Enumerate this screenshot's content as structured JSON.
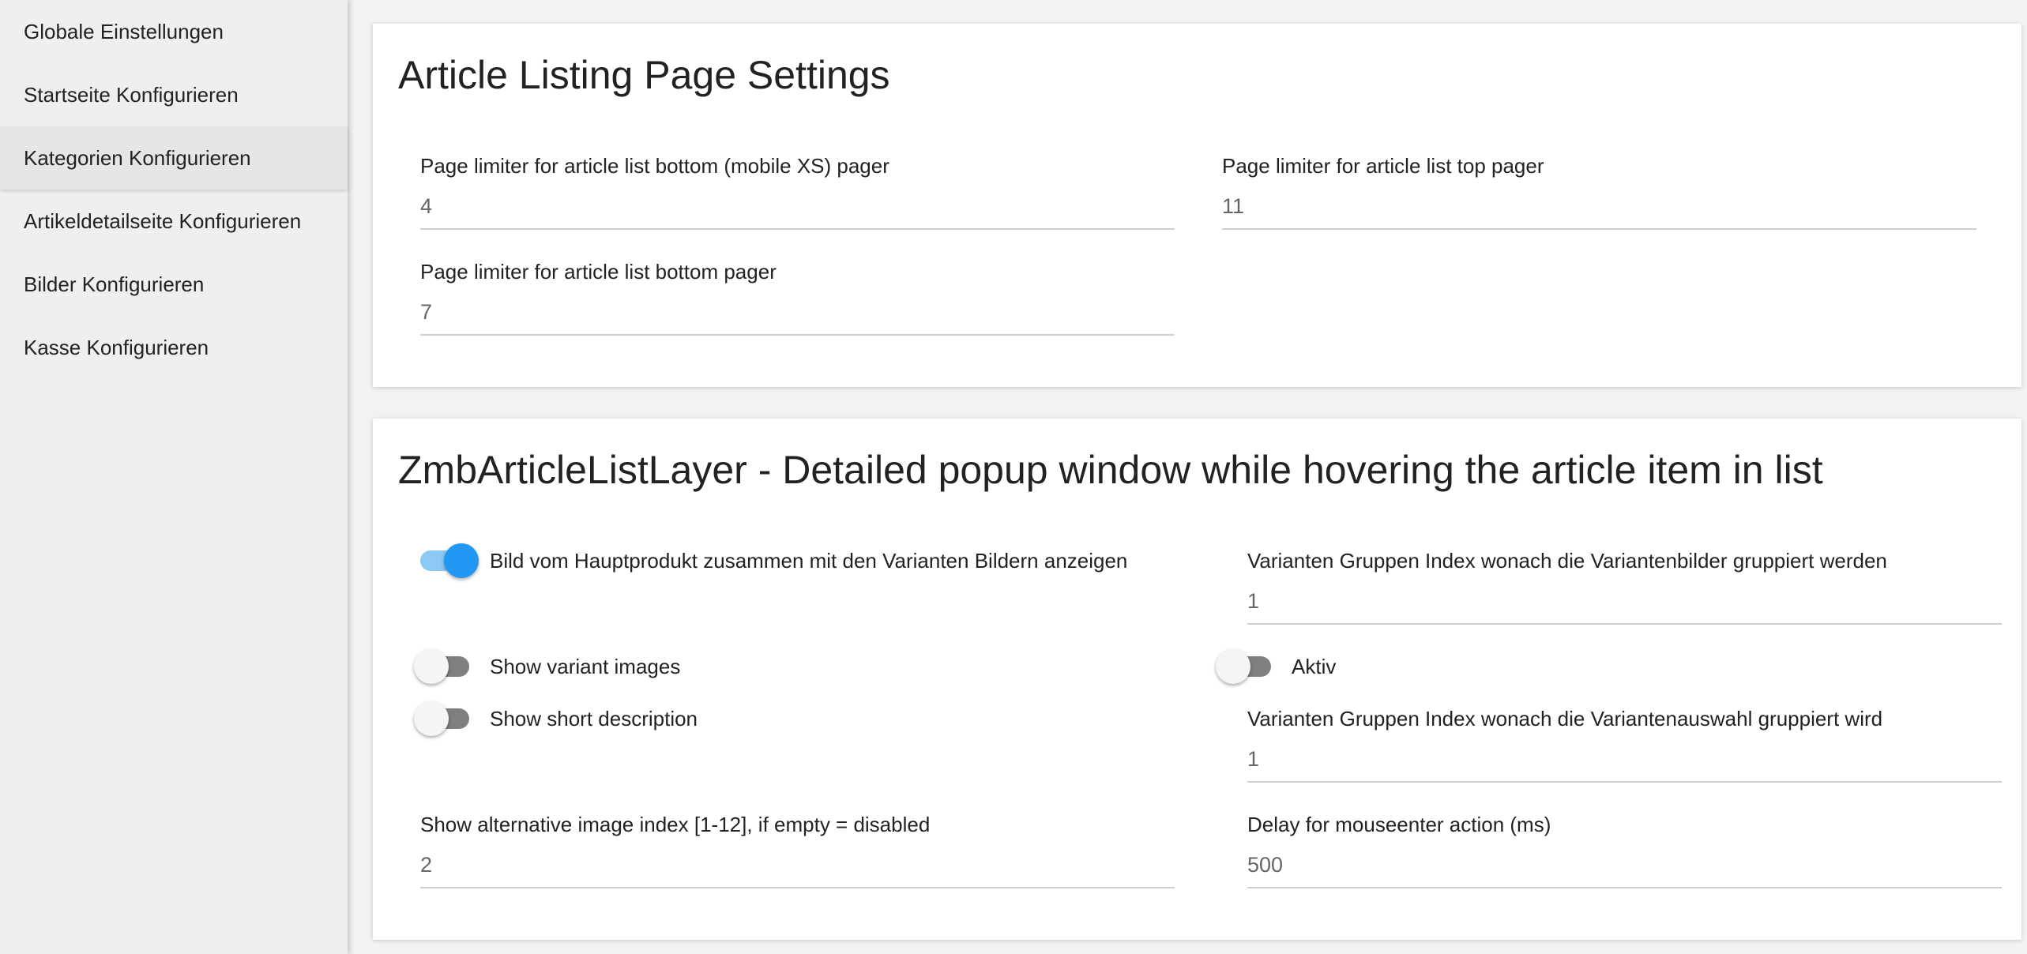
{
  "sidebar": {
    "items": [
      {
        "label": "Globale Einstellungen"
      },
      {
        "label": "Startseite Konfigurieren"
      },
      {
        "label": "Kategorien Konfigurieren"
      },
      {
        "label": "Artikeldetailseite Konfigurieren"
      },
      {
        "label": "Bilder Konfigurieren"
      },
      {
        "label": "Kasse Konfigurieren"
      }
    ],
    "active_index": 2
  },
  "card1": {
    "title": "Article Listing Page Settings",
    "fields": {
      "bottom_mobile": {
        "label": "Page limiter for article list bottom (mobile XS) pager",
        "value": "4"
      },
      "top": {
        "label": "Page limiter for article list top pager",
        "value": "11"
      },
      "bottom": {
        "label": "Page limiter for article list bottom pager",
        "value": "7"
      }
    }
  },
  "card2": {
    "title": "ZmbArticleListLayer - Detailed popup window while hovering the article item in list",
    "toggles": {
      "main_with_variants": {
        "label": "Bild vom Hauptprodukt zusammen mit den Varianten Bildern anzeigen",
        "on": true
      },
      "variant_images": {
        "label": "Show variant images",
        "on": false
      },
      "aktiv": {
        "label": "Aktiv",
        "on": false
      },
      "short_description": {
        "label": "Show short description",
        "on": false
      }
    },
    "fields": {
      "variant_group_images": {
        "label": "Varianten Gruppen Index wonach die Variantenbilder gruppiert werden",
        "value": "1"
      },
      "variant_group_selection": {
        "label": "Varianten Gruppen Index wonach die Variantenauswahl gruppiert wird",
        "value": "1"
      },
      "alt_image_index": {
        "label": "Show alternative image index [1-12], if empty = disabled",
        "value": "2"
      },
      "mouseenter_delay": {
        "label": "Delay for mouseenter action (ms)",
        "value": "500"
      }
    }
  },
  "colors": {
    "accent": "#2196f3",
    "accent_track": "#8cc9f5",
    "toggle_off_track": "#7f7f7f",
    "sidebar_bg": "#efefef",
    "card_bg": "#ffffff"
  }
}
